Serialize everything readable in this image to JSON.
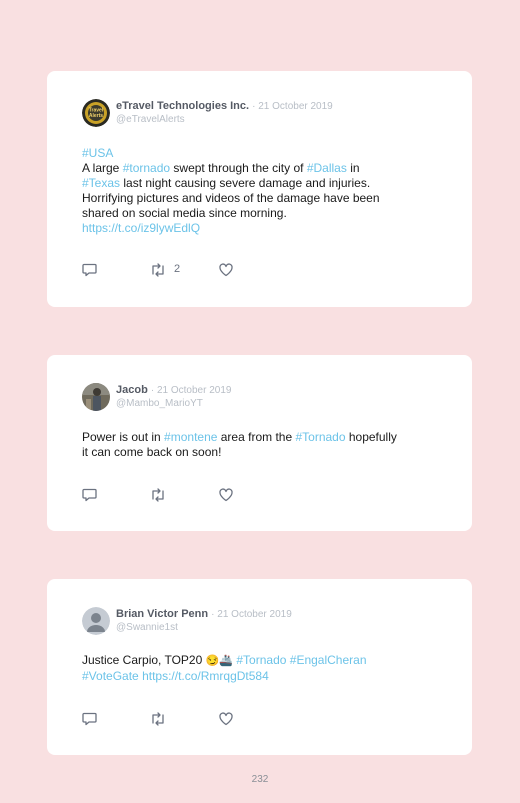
{
  "tweets": [
    {
      "name": "eTravel Technologies Inc.",
      "date": "· 21 October 2019",
      "handle": "@eTravelAlerts",
      "avatar_text": "Travel Alerts",
      "text": {
        "l1_tag": "#USA",
        "l2_a": "A large ",
        "l2_tag1": "#tornado",
        "l2_b": " swept through the city of ",
        "l2_tag2": "#Dallas",
        "l2_c": " in",
        "l3_tag": "#Texas",
        "l3_a": " last night causing severe damage and injuries.",
        "l4": "Horrifying pictures and videos of the damage have been",
        "l5": "shared on social media since morning.",
        "l6_link": "https://t.co/iz9lywEdlQ"
      },
      "retweets": "2"
    },
    {
      "name": "Jacob",
      "date": "· 21 October 2019",
      "handle": "@Mambo_MarioYT",
      "text": {
        "l1_a": "Power is out in ",
        "l1_tag1": "#montene",
        "l1_b": " area from the ",
        "l1_tag2": "#Tornado",
        "l1_c": " hopefully",
        "l2": "it can come back on soon!"
      }
    },
    {
      "name": "Brian Victor Penn",
      "date": "· 21 October 2019",
      "handle": "@Swannie1st",
      "text": {
        "l1_a": "Justice Carpio, TOP20 ",
        "l1_emoji": "😏🚢",
        "l1_sp": " ",
        "l1_tag1": "#Tornado",
        "l1_sp2": " ",
        "l1_tag2": "#EngalCheran",
        "l2_tag": "#VoteGate",
        "l2_sp": " ",
        "l2_link": "https://t.co/RmrqgDt584"
      }
    }
  ],
  "icons": [
    "reply-icon",
    "retweet-icon",
    "like-icon"
  ],
  "colors": {
    "background": "#f9e0e1",
    "hashtag": "#6cc3e8",
    "card": "#ffffff"
  },
  "page_number": "232"
}
